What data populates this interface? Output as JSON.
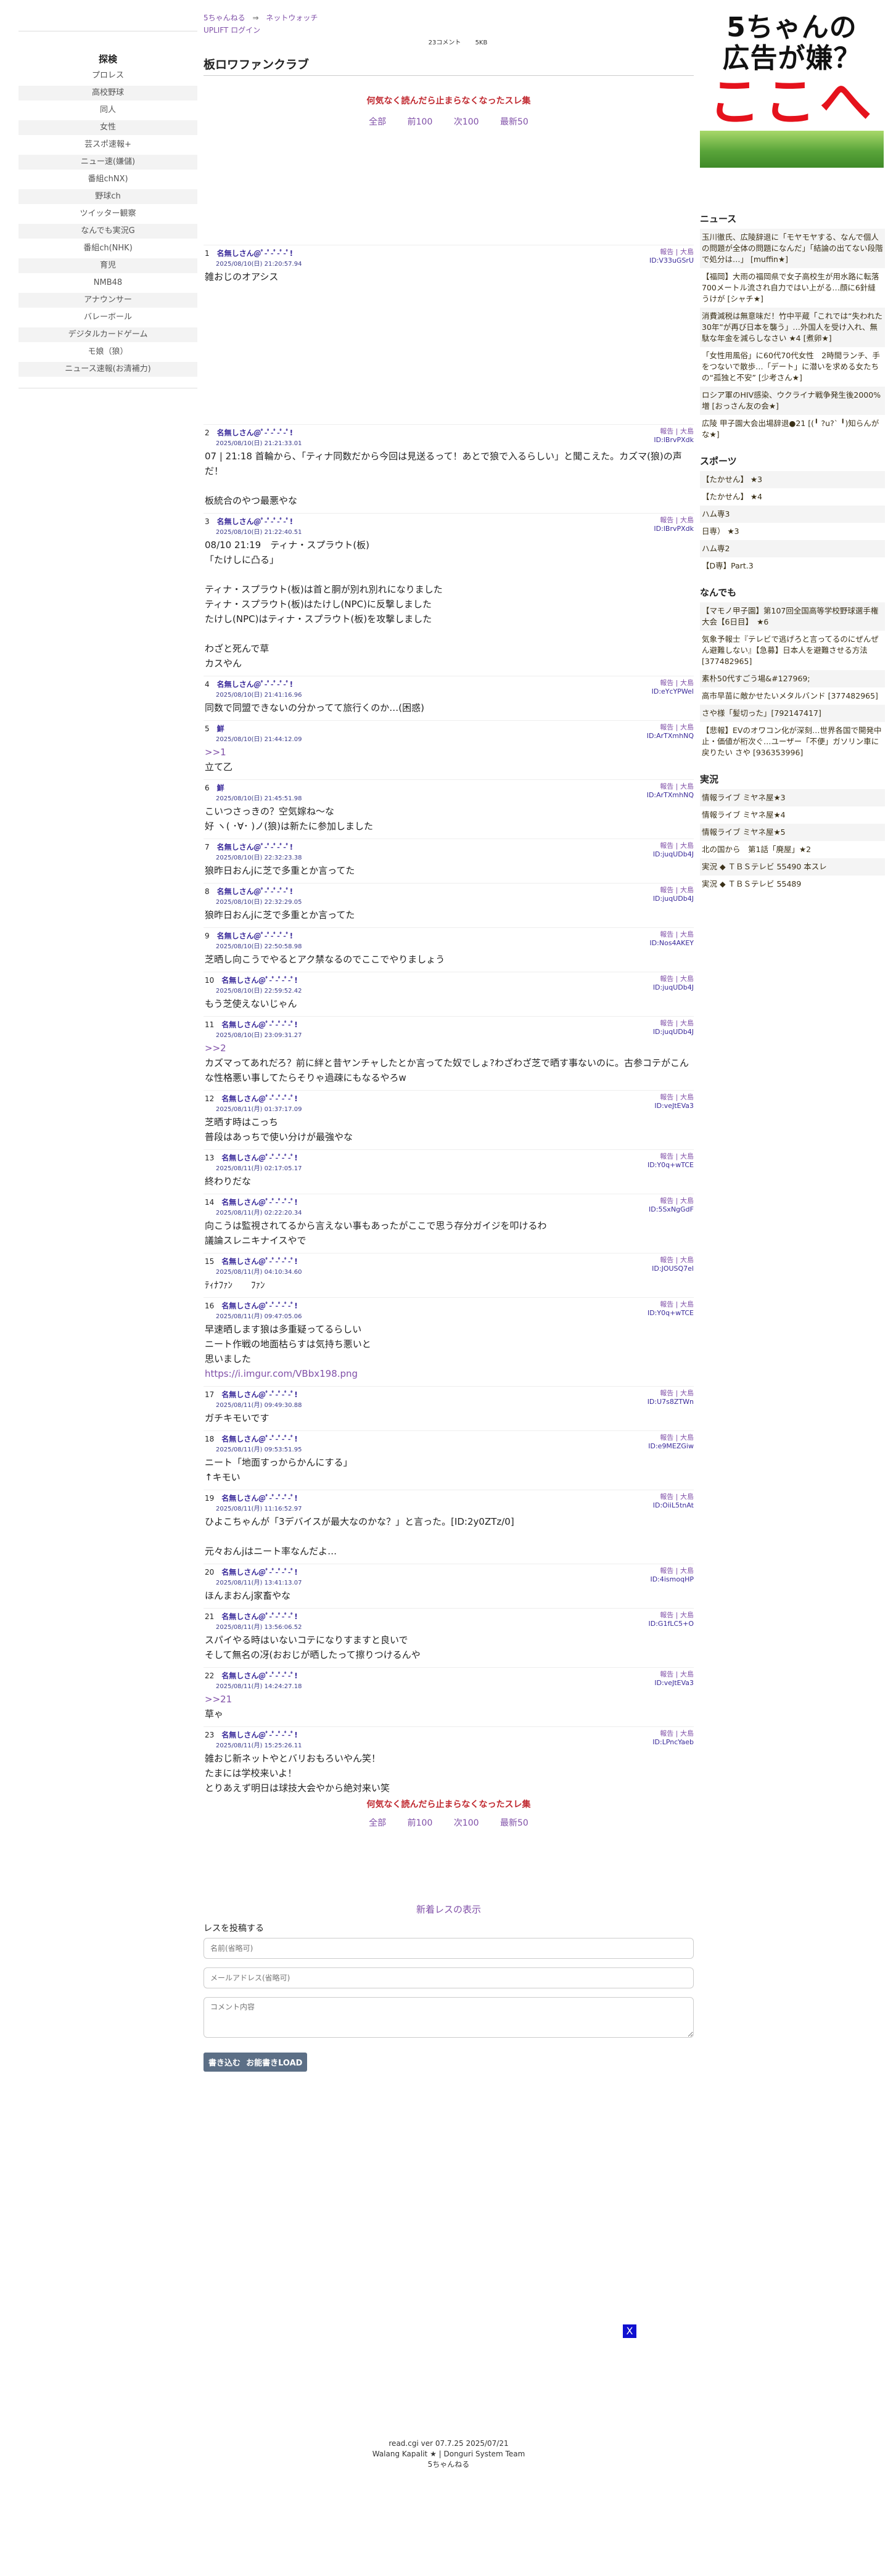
{
  "breadcrumb": {
    "site": "5ちゃんねる",
    "arrow": "⇒",
    "board": "ネットウォッチ"
  },
  "subnav": {
    "upliftlogin": "UPLIFT ログイン"
  },
  "meta": {
    "comments": "23コメント",
    "size": "5KB"
  },
  "thread": {
    "title": "板ロワファンクラブ"
  },
  "notice": "何気なく読んだら止まらなくなったスレ集",
  "pager": {
    "all": "全部",
    "prev": "前100",
    "next": "次100",
    "latest": "最新50"
  },
  "sidebar": {
    "heading": "探検",
    "items": [
      "プロレス",
      "高校野球",
      "同人",
      "女性",
      "芸スポ速報+",
      "ニュー速(嫌儲)",
      "番組chNX)",
      "野球ch",
      "ツイッター観察",
      "なんでも実況G",
      "番組ch(NHK)",
      "育児",
      "NMB48",
      "アナウンサー",
      "バレーボール",
      "デジタルカードゲーム",
      "モ娘（狼）",
      "ニュース速報(お清補力)"
    ]
  },
  "posts": [
    {
      "num": "1",
      "name": "名無しさん@ﾟ-ﾟ-ﾟ-ﾟ-ﾟ!",
      "date": "2025/08/10(日) 21:20:57.94",
      "actions": "報告 | 大島",
      "id": "ID:V33uGSrU",
      "lines": [
        "雑おじのオアシス"
      ]
    },
    {
      "num": "2",
      "name": "名無しさん@ﾟ-ﾟ-ﾟ-ﾟ-ﾟ!",
      "date": "2025/08/10(日) 21:21:33.01",
      "actions": "報告 | 大島",
      "id": "ID:lBrvPXdk",
      "lines": [
        "07 | 21:18 首輪から、「ティナ同数だから今回は見送るって！あとで狼で入るらしい」と聞こえた。カズマ(狼)の声だ！",
        "",
        "板統合のやつ最悪やな"
      ]
    },
    {
      "num": "3",
      "name": "名無しさん@ﾟ-ﾟ-ﾟ-ﾟ-ﾟ!",
      "date": "2025/08/10(日) 21:22:40.51",
      "actions": "報告 | 大島",
      "id": "ID:lBrvPXdk",
      "lines": [
        "08/10 21:19　ティナ・スプラウト(板)",
        "「たけしに凸る」",
        "",
        "ティナ・スプラウト(板)は首と胴が別れ別れになりました",
        "ティナ・スプラウト(板)はたけし(NPC)に反撃しました",
        "たけし(NPC)はティナ・スプラウト(板)を攻撃しました",
        "",
        "わざと死んで草",
        "カスやん"
      ]
    },
    {
      "num": "4",
      "name": "名無しさん@ﾟ-ﾟ-ﾟ-ﾟ-ﾟ!",
      "date": "2025/08/10(日) 21:41:16.96",
      "actions": "報告 | 大島",
      "id": "ID:eYcYPWel",
      "lines": [
        "同数で同盟できないの分かってて旅行くのか…(困惑)"
      ]
    },
    {
      "num": "5",
      "name": "鮮",
      "date": "2025/08/10(日) 21:44:12.09",
      "actions": "報告 | 大島",
      "id": "ID:ArTXmhNQ",
      "anchor": ">>1",
      "lines": [
        "立て乙"
      ]
    },
    {
      "num": "6",
      "name": "鮮",
      "date": "2025/08/10(日) 21:45:51.98",
      "actions": "報告 | 大島",
      "id": "ID:ArTXmhNQ",
      "lines": [
        "こいつさっきの？空気嫁ね～な",
        "好 ヽ( ･∀･ )ノ(狼)は新たに参加しました"
      ]
    },
    {
      "num": "7",
      "name": "名無しさん@ﾟ-ﾟ-ﾟ-ﾟ-ﾟ!",
      "date": "2025/08/10(日) 22:32:23.38",
      "actions": "報告 | 大島",
      "id": "ID:juqUDb4J",
      "lines": [
        "狼昨日おんjに芝で多重とか言ってた"
      ]
    },
    {
      "num": "8",
      "name": "名無しさん@ﾟ-ﾟ-ﾟ-ﾟ-ﾟ!",
      "date": "2025/08/10(日) 22:32:29.05",
      "actions": "報告 | 大島",
      "id": "ID:juqUDb4J",
      "lines": [
        "狼昨日おんjに芝で多重とか言ってた"
      ]
    },
    {
      "num": "9",
      "name": "名無しさん@ﾟ-ﾟ-ﾟ-ﾟ-ﾟ!",
      "date": "2025/08/10(日) 22:50:58.98",
      "actions": "報告 | 大島",
      "id": "ID:Nos4AKEY",
      "lines": [
        "芝晒し向こうでやるとアク禁なるのでここでやりましょう"
      ]
    },
    {
      "num": "10",
      "name": "名無しさん@ﾟ-ﾟ-ﾟ-ﾟ-ﾟ!",
      "date": "2025/08/10(日) 22:59:52.42",
      "actions": "報告 | 大島",
      "id": "ID:juqUDb4J",
      "lines": [
        "もう芝使えないじゃん"
      ]
    },
    {
      "num": "11",
      "name": "名無しさん@ﾟ-ﾟ-ﾟ-ﾟ-ﾟ!",
      "date": "2025/08/10(日) 23:09:31.27",
      "actions": "報告 | 大島",
      "id": "ID:juqUDb4J",
      "anchor": ">>2",
      "lines": [
        "カズマってあれだろ？前に絆と昔ヤンチャしたとか言ってた奴でしょ?わざわざ芝で晒す事ないのに。古参コテがこんな性格悪い事してたらそりゃ過疎にもなるやろw"
      ]
    },
    {
      "num": "12",
      "name": "名無しさん@ﾟ-ﾟ-ﾟ-ﾟ-ﾟ!",
      "date": "2025/08/11(月) 01:37:17.09",
      "actions": "報告 | 大島",
      "id": "ID:veJtEVa3",
      "lines": [
        "芝晒す時はこっち",
        "普段はあっちで使い分けが最強やな"
      ]
    },
    {
      "num": "13",
      "name": "名無しさん@ﾟ-ﾟ-ﾟ-ﾟ-ﾟ!",
      "date": "2025/08/11(月) 02:17:05.17",
      "actions": "報告 | 大島",
      "id": "ID:Y0q+wTCE",
      "lines": [
        "終わりだな"
      ]
    },
    {
      "num": "14",
      "name": "名無しさん@ﾟ-ﾟ-ﾟ-ﾟ-ﾟ!",
      "date": "2025/08/11(月) 02:22:20.34",
      "actions": "報告 | 大島",
      "id": "ID:5SxNgGdF",
      "lines": [
        "向こうは監視されてるから言えない事もあったがここで思う存分ガイジを叩けるわ",
        "議論スレニキナイスやで"
      ]
    },
    {
      "num": "15",
      "name": "名無しさん@ﾟ-ﾟ-ﾟ-ﾟ-ﾟ!",
      "date": "2025/08/11(月) 04:10:34.60",
      "actions": "報告 | 大島",
      "id": "ID:JOUSQ7el",
      "lines": [
        "ﾃｨﾅﾌｧﾝ　　ﾌｧﾝ"
      ]
    },
    {
      "num": "16",
      "name": "名無しさん@ﾟ-ﾟ-ﾟ-ﾟ-ﾟ!",
      "date": "2025/08/11(月) 09:47:05.06",
      "actions": "報告 | 大島",
      "id": "ID:Y0q+wTCE",
      "lines": [
        "早速晒します狼は多重疑ってるらしい",
        "ニート作戦の地面枯らすは気持ち悪いと",
        "思いました"
      ],
      "link": "https://i.imgur.com/VBbx198.png"
    },
    {
      "num": "17",
      "name": "名無しさん@ﾟ-ﾟ-ﾟ-ﾟ-ﾟ!",
      "date": "2025/08/11(月) 09:49:30.88",
      "actions": "報告 | 大島",
      "id": "ID:U7s8ZTWn",
      "lines": [
        "ガチキモいです"
      ]
    },
    {
      "num": "18",
      "name": "名無しさん@ﾟ-ﾟ-ﾟ-ﾟ-ﾟ!",
      "date": "2025/08/11(月) 09:53:51.95",
      "actions": "報告 | 大島",
      "id": "ID:e9MEZGiw",
      "lines": [
        "ニート「地面すっからかんにする」",
        "↑キモい"
      ]
    },
    {
      "num": "19",
      "name": "名無しさん@ﾟ-ﾟ-ﾟ-ﾟ-ﾟ!",
      "date": "2025/08/11(月) 11:16:52.97",
      "actions": "報告 | 大島",
      "id": "ID:OiiL5tnAt",
      "lines": [
        "ひよこちゃんが「3デバイスが最大なのかな？」と言った。[ID:2y0ZTz/0]",
        "",
        "元々おんjはニート率なんだよ…"
      ]
    },
    {
      "num": "20",
      "name": "名無しさん@ﾟ-ﾟ-ﾟ-ﾟ-ﾟ!",
      "date": "2025/08/11(月) 13:41:13.07",
      "actions": "報告 | 大島",
      "id": "ID:4ismoqHP",
      "lines": [
        "ほんまおんj家畜やな"
      ]
    },
    {
      "num": "21",
      "name": "名無しさん@ﾟ-ﾟ-ﾟ-ﾟ-ﾟ!",
      "date": "2025/08/11(月) 13:56:06.52",
      "actions": "報告 | 大島",
      "id": "ID:G1fLC5+O",
      "lines": [
        "スパイやる時はいないコテになりすますと良いで",
        "そして無名の冴(おおじが晒したって擦りつけるんや"
      ]
    },
    {
      "num": "22",
      "name": "名無しさん@ﾟ-ﾟ-ﾟ-ﾟ-ﾟ!",
      "date": "2025/08/11(月) 14:24:27.18",
      "actions": "報告 | 大島",
      "id": "ID:veJtEVa3",
      "anchor": ">>21",
      "lines": [
        "草ゃ"
      ]
    },
    {
      "num": "23",
      "name": "名無しさん@ﾟ-ﾟ-ﾟ-ﾟ-ﾟ!",
      "date": "2025/08/11(月) 15:25:26.11",
      "actions": "報告 | 大島",
      "id": "ID:LPncYaeb",
      "lines": [
        "雑おじ新ネットやとバリおもろいやん笑！",
        "たまには学校来いよ！",
        "とりあえず明日は球技大会やから絶対来い笑"
      ]
    }
  ],
  "form": {
    "title": "新着レスの表示",
    "label": "レスを投稿する",
    "name_placeholder": "名前(省略可)",
    "mail_placeholder": "メールアドレス(省略可)",
    "comment_placeholder": "コメント内容",
    "submit": "書き込む",
    "extra": "お能書きLOAD"
  },
  "xbox": "X",
  "footer": {
    "line1": "read.cgi ver 07.7.25 2025/07/21",
    "line2": "Walang Kapalit ★ | Donguri System Team",
    "line3": "5ちゃんねる"
  },
  "ad": {
    "line1": "5ちゃんの",
    "line2": "広告が嫌？",
    "line3": "ここへ"
  },
  "news": {
    "heading": "ニュース",
    "items": [
      "玉川徹氏、広陵辞退に「モヤモヤする、なんで個人の問題が全体の問題になんだ」「結論の出てない段階で処分は…」 [muffin★]",
      "【福岡】大雨の福岡県で女子高校生が用水路に転落　700メートル流され自力ではい上がる…顔に6針縫うけが [シャチ★]",
      "消費減税は無意味だ！竹中平蔵「これでは“失われた30年”が再び日本を襲う」…外国人を受け入れ、無駄な年金を減らしなさい ★4 [煮卵★]",
      "「女性用風俗」に60代70代女性　2時間ランチ、手をつないで散歩…「デート」に潜いを求める女たちの“孤独と不安” [少考さん★]",
      "ロシア軍のHIV感染、ウクライナ戦争発生後2000%増 [おっさん友の会★]",
      "広陵 甲子園大会出場辞退●21 [(╹ ?u?` ╹)知らんがな★]"
    ]
  },
  "sports": {
    "heading": "スポーツ",
    "items": [
      "【たかせん】 ★3",
      "【たかせん】 ★4",
      "ハム専3",
      "日専） ★3",
      "ハム専2",
      "【D専】Part.3"
    ]
  },
  "anything": {
    "heading": "なんでも",
    "items": [
      "【マモノ甲子園】第107回全国高等学校野球選手権大会【6日目】　★6",
      "気象予報士『テレビで逃げろと言ってるのにぜんぜん避難しない』【急募】日本人を避難させる方法 [377482965]",
      "素朴50代すごう場&#127969;",
      "高市早苗に敵かせたいメタルバンド [377482965]",
      "さや様「髪切った」[792147417]",
      "【悲報】EVのオワコン化が深刻…世界各国で開発中止・価値が桁次ぐ…ユーザー「不便」ガソリン車に戻りたい さや [936353996]"
    ]
  },
  "jikkyo": {
    "heading": "実況",
    "items": [
      "情報ライブ ミヤネ屋★3",
      "情報ライブ ミヤネ屋★4",
      "情報ライブ ミヤネ屋★5",
      "北の国から　第1話「廃屋」★2",
      "実況 ◆ ＴＢＳテレビ 55490 本スレ",
      "実況 ◆ ＴＢＳテレビ 55489"
    ]
  }
}
